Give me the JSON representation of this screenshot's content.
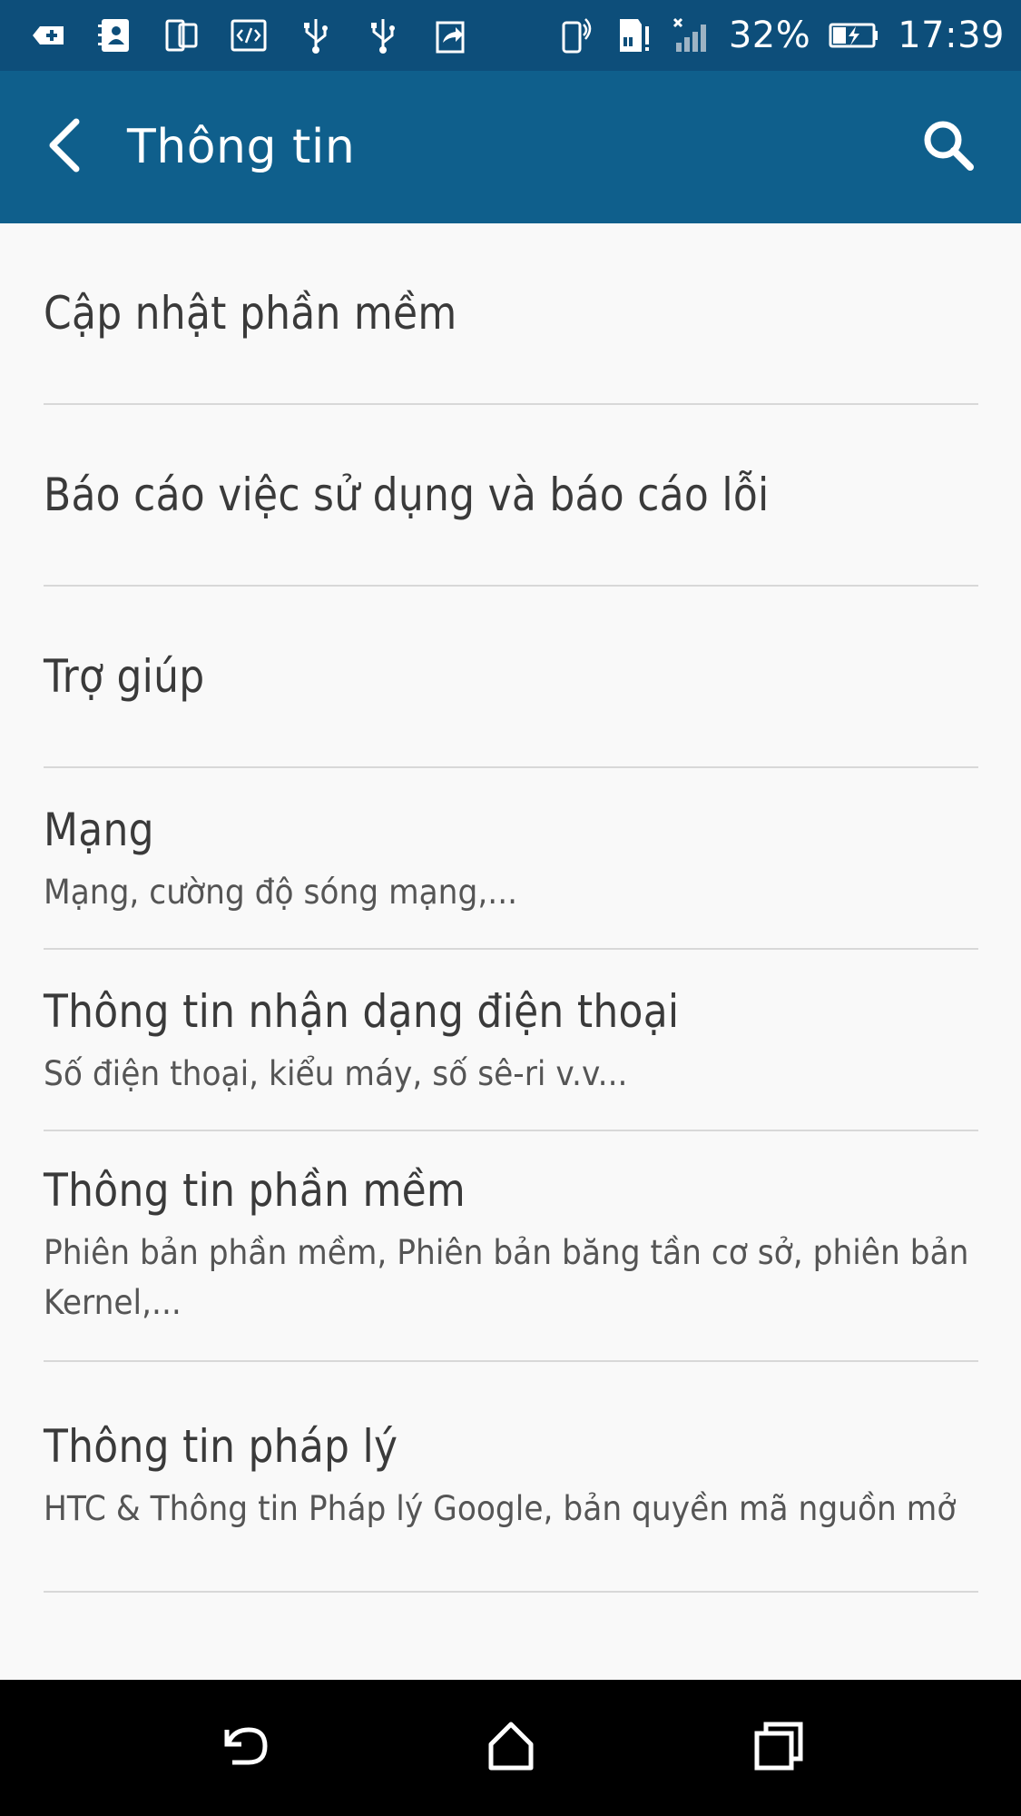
{
  "status_bar": {
    "icons": [
      "plus-box-icon",
      "contacts-icon",
      "dual-screen-icon",
      "code-icon",
      "usb-icon",
      "usb-icon",
      "share-icon"
    ],
    "right_icons": [
      "phone-vibrate-icon",
      "sd-card-alert-icon",
      "signal-no-sim-icon"
    ],
    "battery": "32%",
    "time": "17:39"
  },
  "app_bar": {
    "title": "Thông tin"
  },
  "items": [
    {
      "title": "Cập nhật phần mềm",
      "subtitle": ""
    },
    {
      "title": "Báo cáo việc sử dụng và báo cáo lỗi",
      "subtitle": ""
    },
    {
      "title": "Trợ giúp",
      "subtitle": ""
    },
    {
      "title": "Mạng",
      "subtitle": "Mạng, cường độ sóng mạng,..."
    },
    {
      "title": "Thông tin nhận dạng điện thoại",
      "subtitle": "Số điện thoại, kiểu máy, số sê-ri v.v..."
    },
    {
      "title": "Thông tin phần mềm",
      "subtitle": "Phiên bản phần mềm, Phiên bản băng tần cơ sở, phiên bản Kernel,..."
    },
    {
      "title": "Thông tin pháp lý",
      "subtitle": "HTC & Thông tin Pháp lý Google, bản quyền mã nguồn mở"
    }
  ],
  "colors": {
    "status_bar": "#0d4e7a",
    "app_bar": "#0f5f8c",
    "background": "#f9f9f9",
    "divider": "#d8d8d8"
  }
}
